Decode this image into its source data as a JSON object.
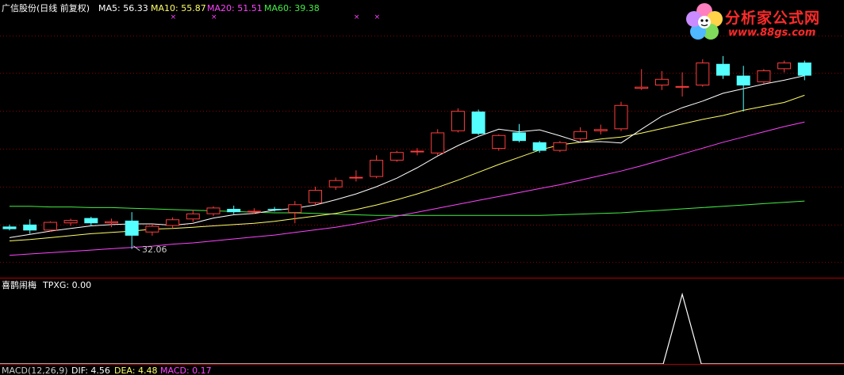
{
  "main_panel": {
    "title": "广信股份(日线 前复权)",
    "ma_labels": [
      {
        "text": "MA5: 56.33",
        "color": "#ffffff"
      },
      {
        "text": "MA10: 55.87",
        "color": "#ffff66"
      },
      {
        "text": "MA20: 51.51",
        "color": "#ff44ff"
      },
      {
        "text": "MA60: 39.38",
        "color": "#44ee44"
      }
    ],
    "low_marker": "32.06"
  },
  "sub_panel": {
    "title": "喜鹊闹梅",
    "tpxg_label": "TPXG: 0.00"
  },
  "macd_panel": {
    "name": "MACD(12,26,9)",
    "dif": "DIF: 4.56",
    "dea": "DEA: 4.48",
    "macd": "MACD: 0.17"
  },
  "logo": {
    "title": "分析家公式网",
    "url": "www.88gs.com"
  },
  "colors": {
    "up": "#ff3c3c",
    "down": "#54ffff",
    "ma5": "#ffffff",
    "ma10": "#ffff66",
    "ma20": "#ff44ff",
    "ma60": "#44ee44",
    "grid": "#8b0000",
    "signal": "#ff44ff"
  },
  "chart_data": {
    "type": "candlestick",
    "price_range": [
      29,
      68
    ],
    "candles": [
      {
        "o": 35.5,
        "h": 35.8,
        "l": 34.9,
        "c": 35.1
      },
      {
        "o": 35.8,
        "h": 36.6,
        "l": 34.4,
        "c": 34.9
      },
      {
        "o": 34.9,
        "h": 36.3,
        "l": 34.7,
        "c": 36.2
      },
      {
        "o": 36.0,
        "h": 36.7,
        "l": 35.6,
        "c": 36.5
      },
      {
        "o": 36.8,
        "h": 37.0,
        "l": 35.6,
        "c": 36.0
      },
      {
        "o": 36.0,
        "h": 36.7,
        "l": 35.4,
        "c": 36.3
      },
      {
        "o": 36.4,
        "h": 37.7,
        "l": 32.06,
        "c": 34.1
      },
      {
        "o": 34.6,
        "h": 35.9,
        "l": 34.1,
        "c": 35.6
      },
      {
        "o": 35.6,
        "h": 36.9,
        "l": 35.3,
        "c": 36.6
      },
      {
        "o": 36.6,
        "h": 38.0,
        "l": 36.2,
        "c": 37.5
      },
      {
        "o": 37.4,
        "h": 38.6,
        "l": 37.1,
        "c": 38.4
      },
      {
        "o": 38.2,
        "h": 38.7,
        "l": 37.4,
        "c": 37.7
      },
      {
        "o": 37.7,
        "h": 38.3,
        "l": 37.4,
        "c": 37.9
      },
      {
        "o": 38.2,
        "h": 38.5,
        "l": 37.8,
        "c": 38.0
      },
      {
        "o": 37.6,
        "h": 39.4,
        "l": 36.0,
        "c": 38.9
      },
      {
        "o": 39.1,
        "h": 41.6,
        "l": 38.8,
        "c": 41.1
      },
      {
        "o": 41.5,
        "h": 43.0,
        "l": 41.1,
        "c": 42.6
      },
      {
        "o": 42.9,
        "h": 44.1,
        "l": 42.4,
        "c": 43.1
      },
      {
        "o": 43.1,
        "h": 46.4,
        "l": 42.9,
        "c": 45.7
      },
      {
        "o": 45.6,
        "h": 47.1,
        "l": 45.4,
        "c": 46.9
      },
      {
        "o": 47.1,
        "h": 47.5,
        "l": 46.4,
        "c": 47.1
      },
      {
        "o": 46.7,
        "h": 50.4,
        "l": 46.4,
        "c": 49.9
      },
      {
        "o": 50.1,
        "h": 53.6,
        "l": 49.9,
        "c": 53.2
      },
      {
        "o": 53.1,
        "h": 53.4,
        "l": 49.5,
        "c": 49.7
      },
      {
        "o": 47.4,
        "h": 49.6,
        "l": 47.1,
        "c": 49.5
      },
      {
        "o": 49.9,
        "h": 51.2,
        "l": 48.4,
        "c": 48.6
      },
      {
        "o": 48.4,
        "h": 48.6,
        "l": 46.8,
        "c": 47.1
      },
      {
        "o": 47.1,
        "h": 48.6,
        "l": 46.9,
        "c": 48.4
      },
      {
        "o": 48.9,
        "h": 50.7,
        "l": 48.5,
        "c": 50.1
      },
      {
        "o": 50.1,
        "h": 51.1,
        "l": 49.6,
        "c": 50.4
      },
      {
        "o": 50.4,
        "h": 54.6,
        "l": 50.1,
        "c": 54.1
      },
      {
        "o": 56.6,
        "h": 59.6,
        "l": 56.4,
        "c": 56.9
      },
      {
        "o": 57.1,
        "h": 59.3,
        "l": 56.4,
        "c": 58.1
      },
      {
        "o": 56.9,
        "h": 59.1,
        "l": 55.4,
        "c": 57.0
      },
      {
        "o": 57.1,
        "h": 61.1,
        "l": 56.9,
        "c": 60.6
      },
      {
        "o": 60.4,
        "h": 61.6,
        "l": 58.1,
        "c": 58.6
      },
      {
        "o": 58.6,
        "h": 60.1,
        "l": 53.1,
        "c": 57.1
      },
      {
        "o": 57.6,
        "h": 59.6,
        "l": 57.4,
        "c": 59.4
      },
      {
        "o": 59.6,
        "h": 60.9,
        "l": 59.1,
        "c": 60.6
      },
      {
        "o": 60.6,
        "h": 60.9,
        "l": 57.9,
        "c": 58.6
      }
    ],
    "ma5": [
      33.8,
      34.3,
      34.8,
      35.2,
      35.6,
      35.8,
      35.9,
      35.9,
      35.7,
      36.0,
      36.8,
      37.3,
      37.5,
      38.0,
      38.3,
      38.8,
      39.6,
      40.5,
      41.6,
      42.9,
      44.5,
      46.3,
      47.9,
      49.3,
      50.4,
      50.0,
      50.3,
      49.4,
      48.4,
      48.5,
      48.3,
      50.4,
      52.4,
      53.7,
      54.7,
      55.9,
      56.6,
      57.3,
      57.9,
      58.6
    ],
    "ma10": [
      33.3,
      33.5,
      33.8,
      34.1,
      34.4,
      34.6,
      34.8,
      35.1,
      35.2,
      35.4,
      35.6,
      35.8,
      36.0,
      36.3,
      36.7,
      37.1,
      37.5,
      38.1,
      38.8,
      39.6,
      40.5,
      41.5,
      42.6,
      43.8,
      45.0,
      46.1,
      47.2,
      48.0,
      48.4,
      48.9,
      49.2,
      49.8,
      50.5,
      51.2,
      51.9,
      52.5,
      53.3,
      53.9,
      54.5,
      55.6
    ],
    "ma20": [
      31.1,
      31.3,
      31.5,
      31.7,
      31.9,
      32.1,
      32.3,
      32.5,
      32.8,
      33.0,
      33.3,
      33.6,
      33.9,
      34.2,
      34.6,
      35.0,
      35.4,
      35.9,
      36.5,
      37.1,
      37.7,
      38.3,
      38.9,
      39.5,
      40.1,
      40.7,
      41.3,
      41.9,
      42.6,
      43.3,
      44.0,
      44.8,
      45.7,
      46.6,
      47.5,
      48.4,
      49.2,
      50.0,
      50.8,
      51.5
    ],
    "ma60": [
      38.6,
      38.6,
      38.5,
      38.5,
      38.4,
      38.4,
      38.3,
      38.2,
      38.1,
      38.0,
      37.9,
      37.8,
      37.7,
      37.6,
      37.6,
      37.5,
      37.4,
      37.3,
      37.2,
      37.2,
      37.2,
      37.2,
      37.2,
      37.2,
      37.2,
      37.2,
      37.2,
      37.3,
      37.4,
      37.5,
      37.6,
      37.8,
      38.0,
      38.2,
      38.4,
      38.6,
      38.8,
      39.0,
      39.2,
      39.4
    ],
    "top_markers": [
      8,
      10,
      17,
      18
    ],
    "tpxg": {
      "peak_index": 33,
      "peak_value": 1,
      "current": 0
    }
  }
}
